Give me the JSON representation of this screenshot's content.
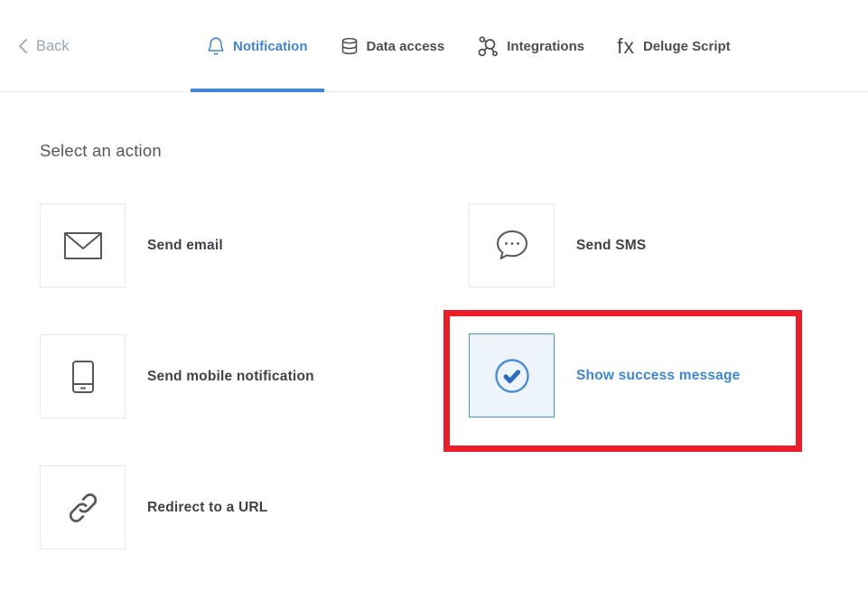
{
  "header": {
    "back_label": "Back",
    "tabs": [
      {
        "label": "Notification",
        "icon": "bell-icon",
        "active": true
      },
      {
        "label": "Data access",
        "icon": "database-icon",
        "active": false
      },
      {
        "label": "Integrations",
        "icon": "integrations-icon",
        "active": false
      },
      {
        "label": "Deluge Script",
        "icon": "fx-icon",
        "icon_glyph": "fx",
        "active": false
      }
    ]
  },
  "main": {
    "heading": "Select an action",
    "actions": [
      {
        "label": "Send email",
        "icon": "email-icon",
        "selected": false
      },
      {
        "label": "Send SMS",
        "icon": "sms-icon",
        "selected": false
      },
      {
        "label": "Send mobile notification",
        "icon": "mobile-icon",
        "selected": false
      },
      {
        "label": "Show success message",
        "icon": "success-check-icon",
        "selected": true
      },
      {
        "label": "Redirect to a URL",
        "icon": "link-icon",
        "selected": false
      }
    ]
  },
  "annotation": {
    "type": "highlight-box",
    "target": "Show success message",
    "color": "#ec1c28"
  },
  "colors": {
    "accent_blue": "#4285d8",
    "link_blue": "#3e86d6",
    "selected_tile_bg": "#eef4fb",
    "selected_tile_border": "#4a90d9",
    "annotation_red": "#ec1c28",
    "text_dark": "#45484d",
    "back_gray": "#9aa6b7",
    "tile_border": "#e9e9e9",
    "header_border": "#ebebeb"
  }
}
